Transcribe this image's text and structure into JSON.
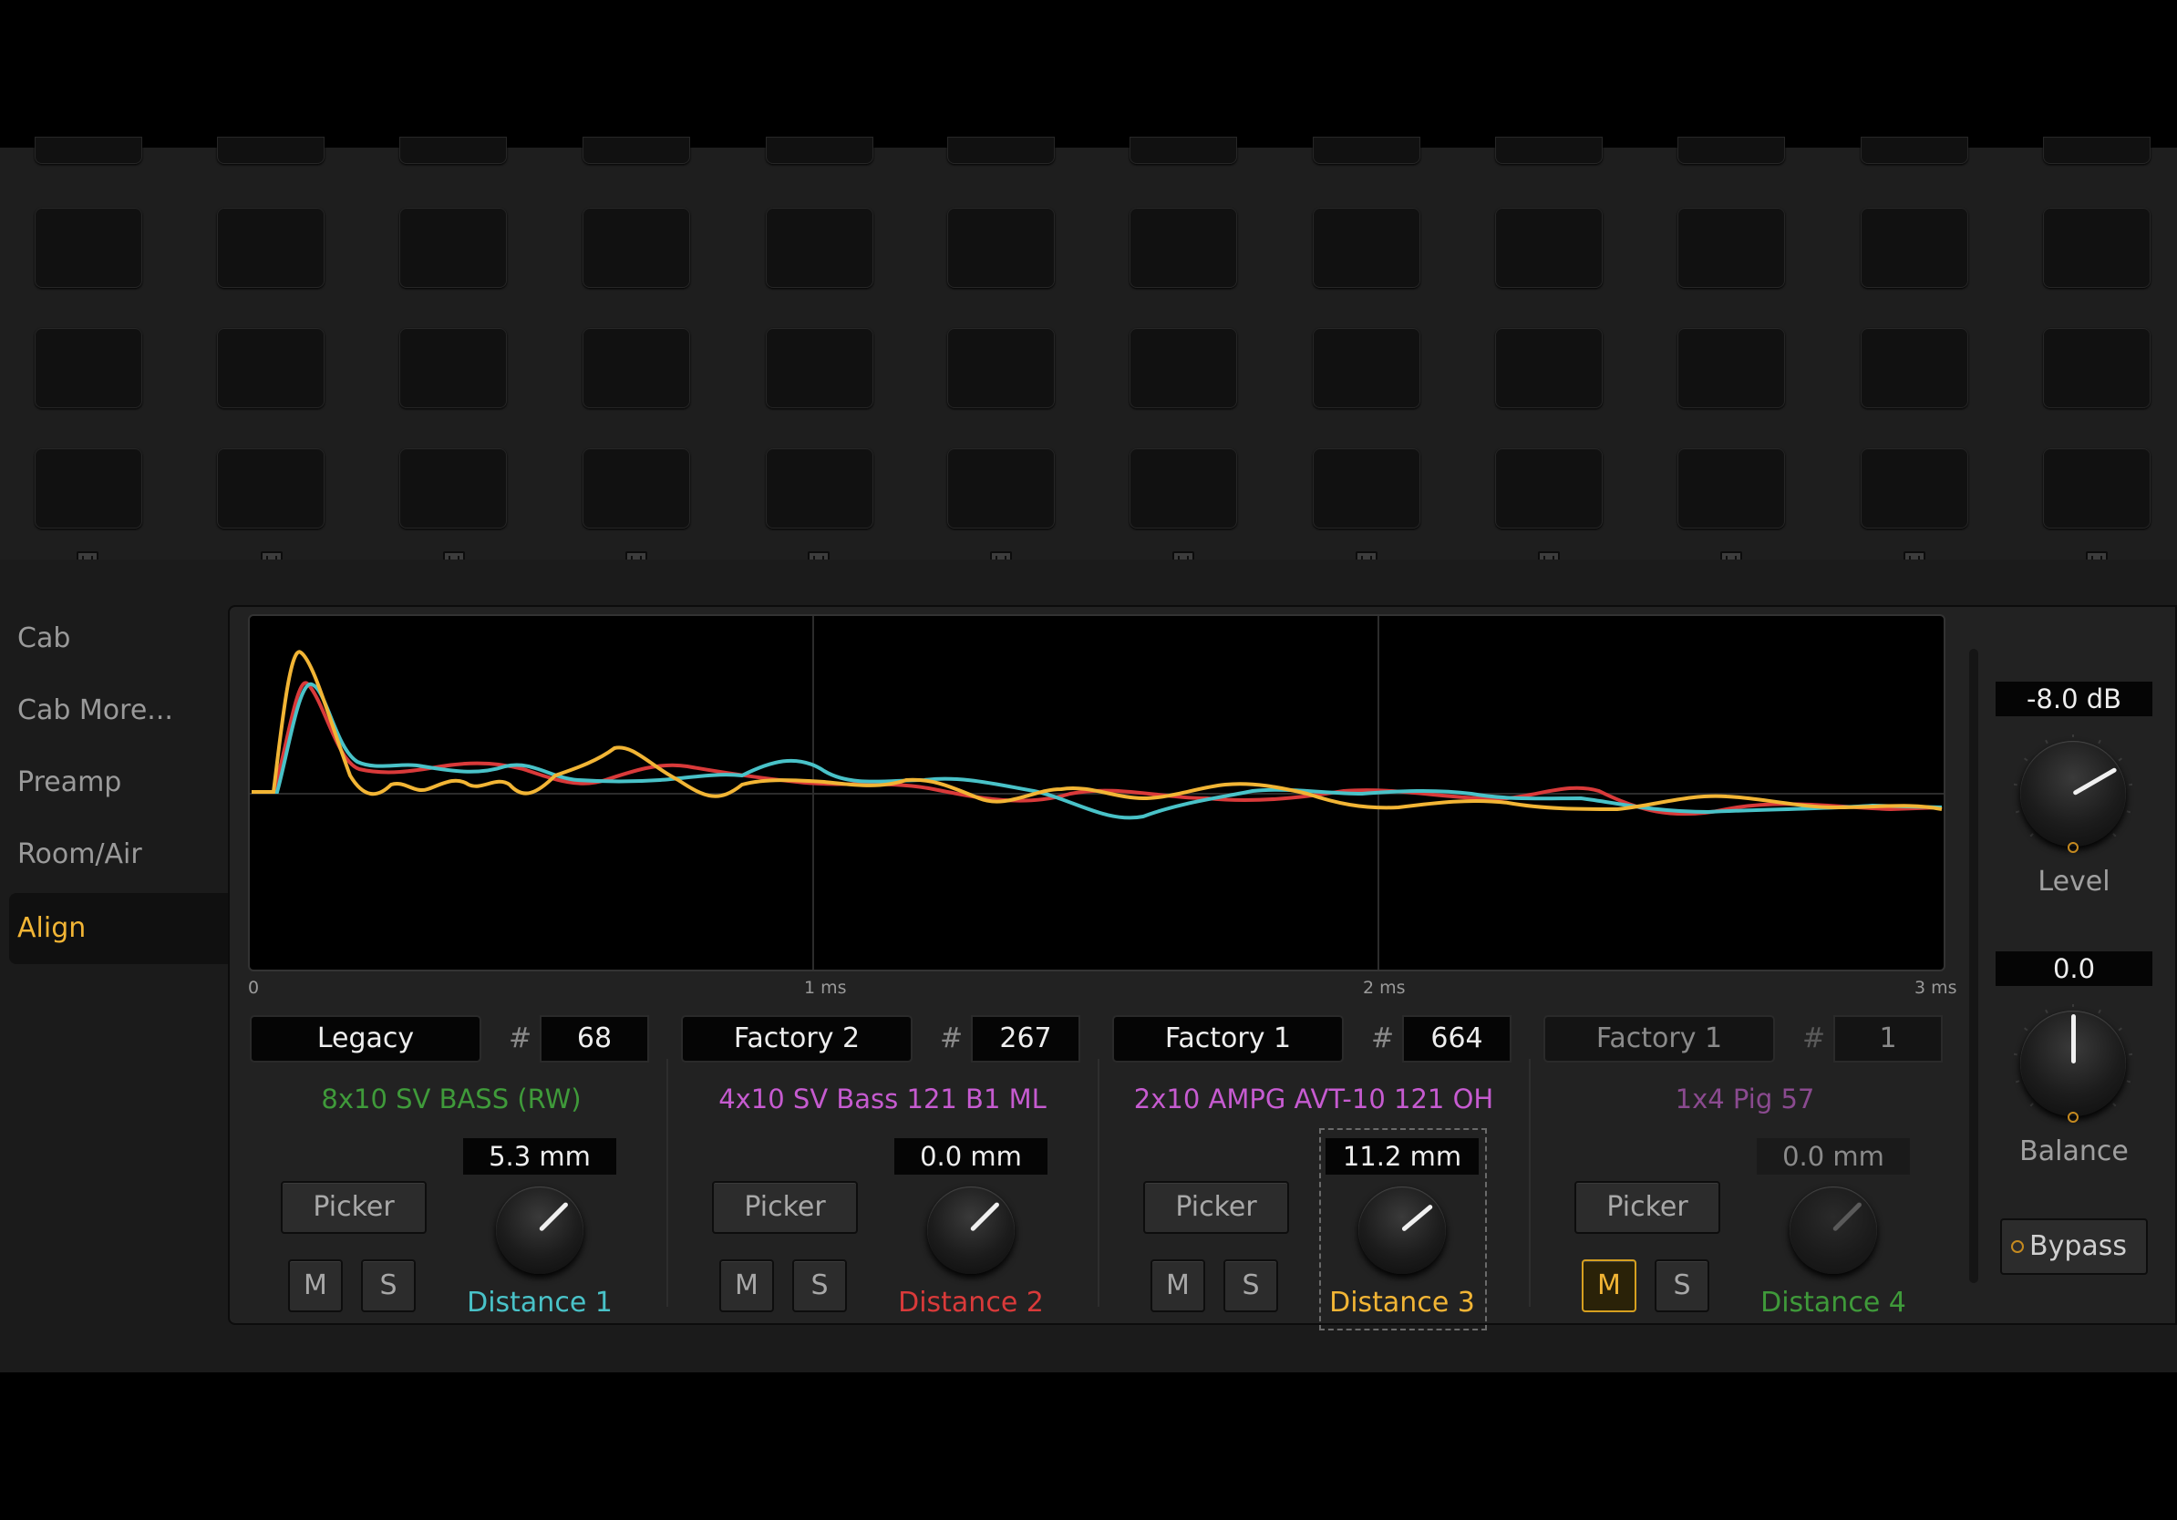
{
  "nav": {
    "items": [
      {
        "label": "Cab"
      },
      {
        "label": "Cab More..."
      },
      {
        "label": "Preamp"
      },
      {
        "label": "Room/Air"
      },
      {
        "label": "Align"
      }
    ],
    "active": "Align"
  },
  "graph": {
    "ticks": [
      "0",
      "1 ms",
      "2 ms",
      "3 ms"
    ]
  },
  "channels": [
    {
      "preset": "Legacy",
      "number": "68",
      "cab": "8x10 SV BASS (RW)",
      "cab_color": "#3f9a3a",
      "picker": "Picker",
      "mute": "M",
      "solo": "S",
      "mute_on": false,
      "distance_value": "5.3 mm",
      "distance_label": "Distance 1",
      "label_color": "#49c2c8"
    },
    {
      "preset": "Factory 2",
      "number": "267",
      "cab": "4x10 SV Bass 121 B1 ML",
      "cab_color": "#c65bd0",
      "picker": "Picker",
      "mute": "M",
      "solo": "S",
      "mute_on": false,
      "distance_value": "0.0 mm",
      "distance_label": "Distance 2",
      "label_color": "#d93a3a"
    },
    {
      "preset": "Factory 1",
      "number": "664",
      "cab": "2x10 AMPG AVT-10 121 OH",
      "cab_color": "#c65bd0",
      "picker": "Picker",
      "mute": "M",
      "solo": "S",
      "mute_on": false,
      "distance_value": "11.2 mm",
      "distance_label": "Distance 3",
      "label_color": "#f2b535"
    },
    {
      "preset": "Factory 1",
      "number": "1",
      "cab": "1x4 Pig 57",
      "cab_color": "#8a4a8f",
      "picker": "Picker",
      "mute": "M",
      "solo": "S",
      "mute_on": true,
      "distance_value": "0.0 mm",
      "distance_label": "Distance 4",
      "label_color": "#3f9a3a"
    }
  ],
  "level": {
    "value": "-8.0 dB",
    "label": "Level"
  },
  "balance": {
    "value": "0.0",
    "label": "Balance"
  },
  "bypass": {
    "label": "Bypass"
  },
  "colors": {
    "accent": "#f2b535",
    "trace_cyan": "#49c2c8",
    "trace_red": "#d93a3a",
    "trace_yellow": "#f2b535"
  }
}
